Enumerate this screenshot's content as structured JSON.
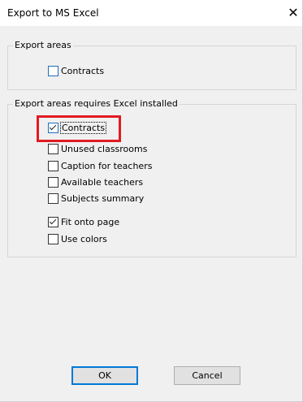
{
  "window": {
    "title": "Export to MS Excel",
    "close_glyph": "✕"
  },
  "group_export_areas": {
    "legend": "Export areas",
    "items": [
      {
        "label": "Contracts",
        "checked": false
      }
    ]
  },
  "group_requires_excel": {
    "legend": "Export areas requires Excel installed",
    "items": [
      {
        "label": "Contracts",
        "checked": true,
        "focused": true,
        "highlighted": true
      },
      {
        "label": "Unused classrooms",
        "checked": false
      },
      {
        "label": "Caption for teachers",
        "checked": false
      },
      {
        "label": "Available teachers",
        "checked": false
      },
      {
        "label": "Subjects summary",
        "checked": false
      }
    ],
    "options": [
      {
        "label": "Fit onto page",
        "checked": true
      },
      {
        "label": "Use colors",
        "checked": false
      }
    ]
  },
  "buttons": {
    "ok": "OK",
    "cancel": "Cancel"
  },
  "colors": {
    "highlight": "#e11b22",
    "focus_blue": "#0078d7"
  },
  "icons": {
    "close": "close-icon",
    "checkmark": "check-icon"
  }
}
